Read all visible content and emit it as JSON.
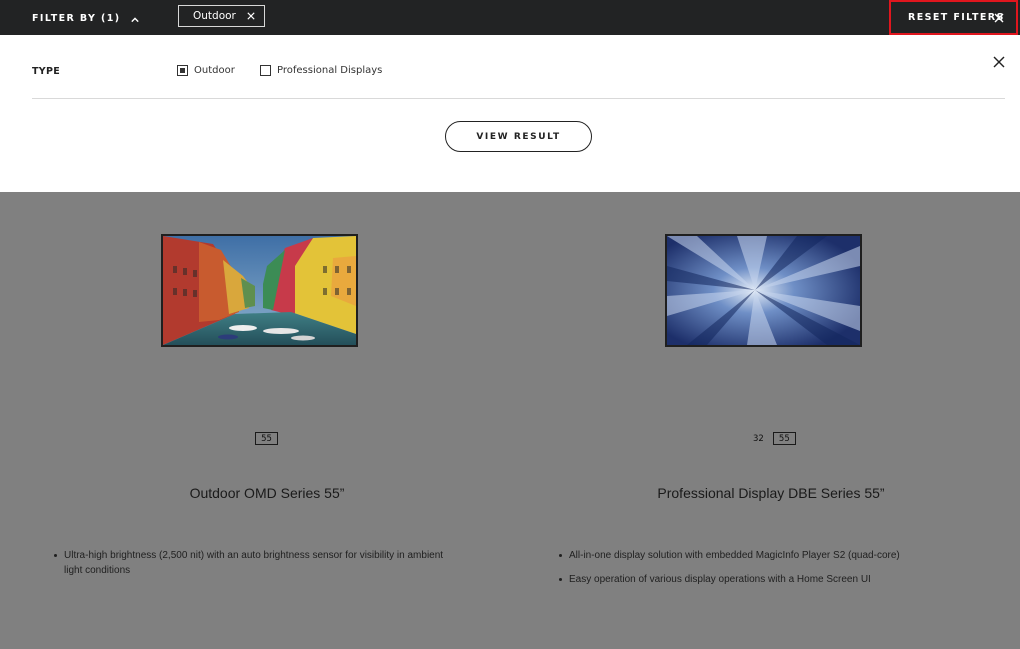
{
  "topbar": {
    "filter_by_label": "FILTER BY (1)",
    "active_chip": "Outdoor",
    "reset_label": "RESET FILTERS"
  },
  "filter_panel": {
    "type_label": "TYPE",
    "options": [
      {
        "label": "Outdoor",
        "checked": true
      },
      {
        "label": "Professional Displays",
        "checked": false
      }
    ],
    "view_result_label": "VIEW RESULT"
  },
  "products": [
    {
      "name": "Outdoor OMD Series 55”",
      "sizes": [
        {
          "label": "55",
          "selected": true
        }
      ],
      "features": [
        "Ultra-high brightness (2,500 nit) with an auto brightness sensor for visibility in ambient light conditions"
      ]
    },
    {
      "name": "Professional Display DBE Series 55”",
      "sizes": [
        {
          "label": "32",
          "selected": false
        },
        {
          "label": "55",
          "selected": true
        }
      ],
      "features": [
        "All-in-one display solution with embedded MagicInfo Player S2 (quad-core)",
        "Easy operation of various display operations with a Home Screen UI"
      ]
    }
  ],
  "colors": {
    "topbar_bg": "#222324",
    "overlay_bg": "#808080",
    "reset_highlight": "#e0161e"
  }
}
